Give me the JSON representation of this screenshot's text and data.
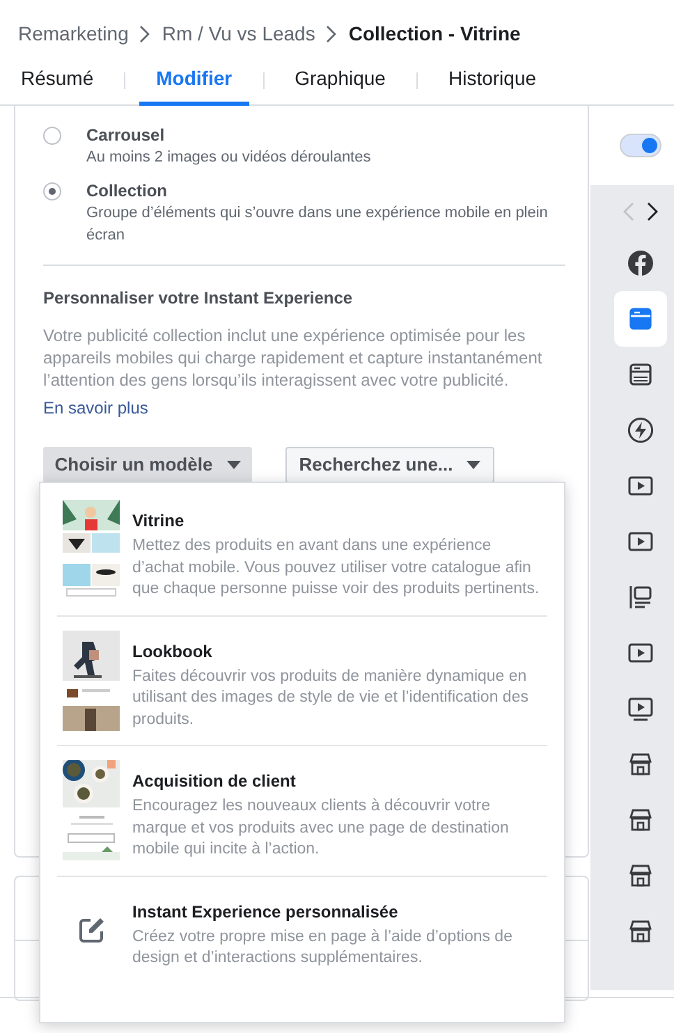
{
  "breadcrumb": [
    {
      "label": "Remarketing",
      "current": false
    },
    {
      "label": "Rm / Vu vs Leads",
      "current": false
    },
    {
      "label": "Collection - Vitrine",
      "current": true
    }
  ],
  "tabs": [
    {
      "label": "Résumé",
      "selected": false
    },
    {
      "label": "Modifier",
      "selected": true
    },
    {
      "label": "Graphique",
      "selected": false
    },
    {
      "label": "Historique",
      "selected": false
    }
  ],
  "format_options": [
    {
      "title": "Carrousel",
      "description": "Au moins 2 images ou vidéos déroulantes",
      "selected": false
    },
    {
      "title": "Collection",
      "description": "Groupe d’éléments qui s’ouvre dans une expérience mobile en plein écran",
      "selected": true
    }
  ],
  "instant_experience": {
    "heading": "Personnaliser votre Instant Experience",
    "description": "Votre publicité collection inclut une expérience optimisée pour les appareils mobiles qui charge rapidement et capture instantanément l’attention des gens lorsqu’ils interagissent avec votre publicité.",
    "link": "En savoir plus"
  },
  "dropdowns": [
    {
      "label": "Choisir un modèle",
      "selected": true
    },
    {
      "label": "Recherchez une...",
      "selected": false
    }
  ],
  "templates": [
    {
      "kind": "picture",
      "title": "Vitrine",
      "description": "Mettez des produits en avant dans une expérience d’achat mobile. Vous pouvez utiliser votre catalogue afin que chaque personne puisse voir des produits pertinents."
    },
    {
      "kind": "picture",
      "title": "Lookbook",
      "description": "Faites découvrir vos produits de manière dynamique en utilisant des images de style de vie et l’identification des produits."
    },
    {
      "kind": "picture",
      "title": "Acquisition de client",
      "description": "Encouragez les nouveaux clients à découvrir votre marque et vos produits avec une page de destination mobile qui incite à l’action."
    },
    {
      "kind": "edit",
      "title": "Instant Experience personnalisée",
      "description": "Créez votre propre mise en page à l’aide d’options de design et d’interactions supplémentaires."
    }
  ],
  "toggle": {
    "on": true
  },
  "rail_icons": [
    {
      "kind": "facebook",
      "selected": false
    },
    {
      "kind": "canvas",
      "selected": true
    },
    {
      "kind": "canvas",
      "selected": false
    },
    {
      "kind": "lightning",
      "selected": false
    },
    {
      "kind": "video",
      "selected": false
    },
    {
      "kind": "video",
      "selected": false
    },
    {
      "kind": "list",
      "selected": false
    },
    {
      "kind": "video",
      "selected": false
    },
    {
      "kind": "video-screen",
      "selected": false
    },
    {
      "kind": "store",
      "selected": false
    },
    {
      "kind": "store",
      "selected": false
    },
    {
      "kind": "store",
      "selected": false
    },
    {
      "kind": "store",
      "selected": false
    }
  ]
}
